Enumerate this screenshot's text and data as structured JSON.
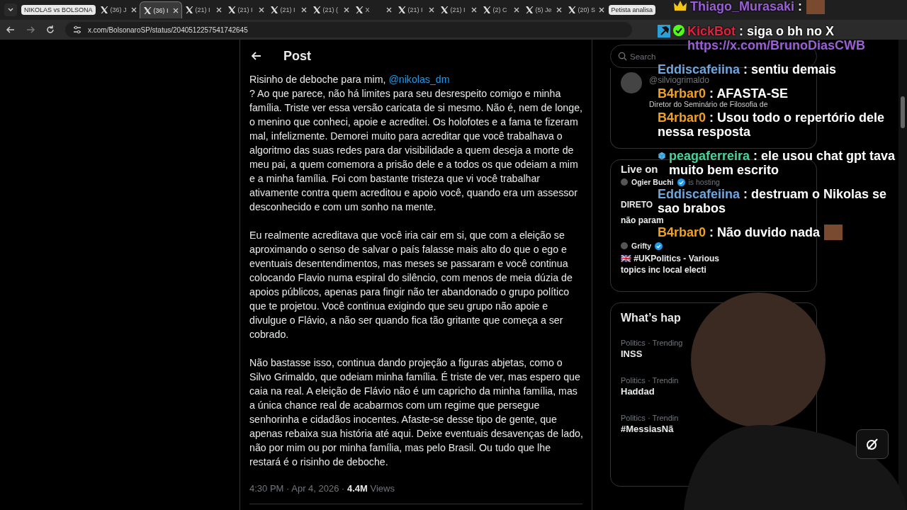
{
  "browser": {
    "tab_group": "NIKOLAS vs BOLSONA",
    "tabs": [
      {
        "label": "(36) J",
        "selected": false
      },
      {
        "label": "(36) I",
        "selected": true
      },
      {
        "label": "(21) I",
        "selected": false
      },
      {
        "label": "(21) I",
        "selected": false
      },
      {
        "label": "(21) I",
        "selected": false
      },
      {
        "label": "(21) (",
        "selected": false
      },
      {
        "label": "X",
        "selected": false
      },
      {
        "label": "(21) I",
        "selected": false
      },
      {
        "label": "(21) I",
        "selected": false
      },
      {
        "label": "(2) C",
        "selected": false
      },
      {
        "label": "(5) Je",
        "selected": false
      },
      {
        "label": "(20) S",
        "selected": false
      }
    ],
    "tab_group_2": "Petista analisa",
    "url": "x.com/BolsonaroSP/status/2040512257541742645"
  },
  "post": {
    "header": "Post",
    "paragraphs": [
      {
        "before": "Risinho de deboche para mim, ",
        "mention": "@nikolas_dm",
        "after": "? Ao que parece, não há limites para seu desrespeito comigo e minha família. Triste ver essa versão caricata de si mesmo. Não é, nem de longe, o menino que conheci, apoie e acreditei. Os holofotes e a fama te fizeram mal, infelizmente. Demorei muito para acreditar que você trabalhava o algoritmo das suas redes para dar visibilidade a quem deseja a morte de meu pai, a quem comemora a prisão dele e a todos os que odeiam a mim e a minha família. Foi com bastante tristeza que vi você trabalhar ativamente contra quem acreditou e apoio você, quando era um assessor desconhecido e com um sonho na mente."
      },
      {
        "before": "Eu realmente acreditava que você iria cair em si, que com a eleição se aproximando o senso de salvar o país falasse mais alto do que o ego e eventuais desentendimentos, mas meses se passaram e você continua colocando Flavio numa espiral do silêncio, com menos de meia dúzia de apoios públicos, apenas para fingir não ter abandonado o grupo político que te projetou. Você continua exigindo que seu grupo não apoie e divulgue o Flávio, a não ser quando fica tão gritante que começa a ser cobrado."
      },
      {
        "before": "Não bastasse isso, continua dando projeção a figuras abjetas, como o Silvo Grimaldo, que odeiam minha família. É triste de ver, mas espero que caia na real. A eleição de Flávio não é um capricho da minha família, mas a única chance real de acabarmos com um regime que persegue senhorinha e cidadãos inocentes. Afaste-se desse tipo de gente, que apenas rebaixa sua história até aqui. Deixe eventuais desavenças de lado, não por mim ou por minha família, mas pelo Brasil. Ou tudo que lhe restará é o risinho de deboche."
      }
    ],
    "time": "4:30 PM · Apr 4, 2026 · ",
    "views_count": "4.4M",
    "views_label": " Views"
  },
  "sidebar": {
    "search": {
      "placeholder": "Search"
    },
    "follow_card": {
      "handle": "@silviogrimaldo",
      "bio": "Diretor do Seminário de Filosofia de"
    },
    "live": {
      "title": "Live on",
      "items": [
        {
          "name": "Ogier Buchi",
          "status": "is hosting",
          "title_1": "DIRETO",
          "title_2": "não param"
        },
        {
          "name": "Grifty",
          "title_1": "🇬🇧 #UKPolitics - Various",
          "title_2": "topics inc local electi"
        }
      ]
    },
    "trends": {
      "title": "What’s hap",
      "items": [
        {
          "meta": "Politics · Trending",
          "topic": "INSS"
        },
        {
          "meta": "Politics · Trendin",
          "topic": "Haddad"
        },
        {
          "meta": "Politics · Trendin",
          "topic": "#MessiasNã"
        }
      ]
    }
  },
  "chat": [
    {
      "user": "Thiago_Murasaki",
      "color": "#9b5fd6",
      "badges": [
        {
          "kind": "crown"
        }
      ],
      "text": ":",
      "emote": true
    },
    {
      "user": "KickBot",
      "color": "#e4223f",
      "badges": [
        {
          "kind": "hammer"
        },
        {
          "kind": "check"
        }
      ],
      "text": ": siga o bh no X",
      "link": "https://x.com/BrunoDiasCWB"
    },
    {
      "user": "Eddiscafeiina",
      "color": "#6ea6de",
      "text": ": sentiu demais"
    },
    {
      "user": "B4rbar0",
      "color": "#f0a21e",
      "text": ": AFASTA-SE"
    },
    {
      "user": "B4rbar0",
      "color": "#f0a21e",
      "text": ": Usou todo o repertório dele nessa resposta"
    },
    {
      "user": "peagaferreira",
      "color": "#48d39b",
      "badges": [
        {
          "kind": "cube"
        }
      ],
      "text": ": ele usou chat gpt tava muito bem escrito"
    },
    {
      "user": "Eddiscafeiina",
      "color": "#6ea6de",
      "text": ": destruam o Nikolas se sao brabos"
    },
    {
      "user": "B4rbar0",
      "color": "#f0a21e",
      "text": ": Não duvido nada",
      "emote": true
    }
  ]
}
